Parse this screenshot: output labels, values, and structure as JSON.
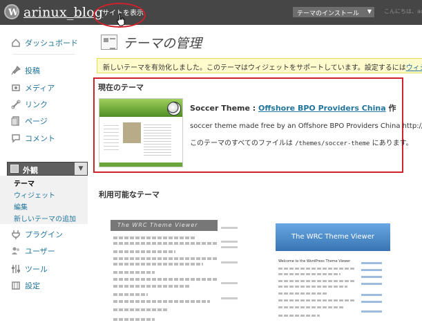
{
  "header": {
    "blog_name": "arinux_blog",
    "view_site": "サイトを表示",
    "theme_install": "テーマのインストール",
    "howdy": "こんにちは、admin"
  },
  "sidebar": {
    "items": [
      {
        "label": "ダッシュボード",
        "icon": "dashboard-icon"
      },
      {
        "label": "投稿",
        "icon": "pin-icon"
      },
      {
        "label": "メディア",
        "icon": "media-icon"
      },
      {
        "label": "リンク",
        "icon": "link-icon"
      },
      {
        "label": "ページ",
        "icon": "page-icon"
      },
      {
        "label": "コメント",
        "icon": "comment-icon"
      },
      {
        "label": "プラグイン",
        "icon": "plugin-icon"
      },
      {
        "label": "ユーザー",
        "icon": "users-icon"
      },
      {
        "label": "ツール",
        "icon": "tools-icon"
      },
      {
        "label": "設定",
        "icon": "settings-icon"
      }
    ],
    "appearance": "外観",
    "submenu": [
      "テーマ",
      "ウィジェット",
      "編集",
      "新しいテーマの追加"
    ]
  },
  "main": {
    "title": "テーマの管理",
    "notice_text": "新しいテーマを有効化しました。このテーマはウィジェットをサポートしています。設定するには",
    "notice_link": "ウィジェット設定",
    "current_heading": "現在のテーマ",
    "theme_name": "Soccer Theme :",
    "theme_author": "Offshore BPO Providers China",
    "theme_author_suffix": "作",
    "theme_desc": "soccer theme made free by an Offshore BPO Providers China http://",
    "theme_files_pre": "このテーマのすべてのファイルは",
    "theme_files_path": "/themes/soccer-theme",
    "theme_files_post": "にあります。",
    "available_heading": "利用可能なテーマ",
    "available_theme_1_header": "The WRC Theme Viewer",
    "available_theme_2_header": "The WRC Theme Viewer",
    "available_theme_2_welcome": "Welcome to the WordPress Theme Viewer"
  },
  "colors": {
    "header_bg": "#464646",
    "link": "#21759b",
    "highlight": "#d0202a",
    "notice_bg": "#fffbcc"
  }
}
